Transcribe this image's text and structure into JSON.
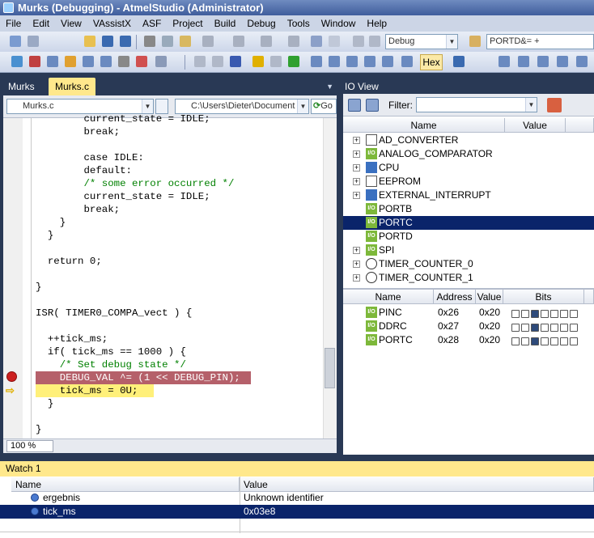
{
  "window": {
    "title": "Murks (Debugging) - AtmelStudio (Administrator)"
  },
  "menu": [
    "File",
    "Edit",
    "View",
    "VAssistX",
    "ASF",
    "Project",
    "Build",
    "Debug",
    "Tools",
    "Window",
    "Help"
  ],
  "toolbar": {
    "config": "Debug",
    "search_value": "PORTD&= +",
    "hex_label": "Hex"
  },
  "tabs": [
    {
      "label": "Murks"
    },
    {
      "label": "Murks.c"
    }
  ],
  "nav": {
    "file": "Murks.c",
    "path": "C:\\Users\\Dieter\\Document",
    "go": "Go"
  },
  "code": {
    "lines": [
      {
        "text": "        current_state = IDLE;",
        "kind": "normal"
      },
      {
        "text": "        break;",
        "kind": "normal"
      },
      {
        "text": "",
        "kind": "normal"
      },
      {
        "text": "        case IDLE:",
        "kind": "normal"
      },
      {
        "text": "        default:",
        "kind": "normal"
      },
      {
        "text": "        /* some error occurred */",
        "kind": "comment"
      },
      {
        "text": "        current_state = IDLE;",
        "kind": "normal"
      },
      {
        "text": "        break;",
        "kind": "normal"
      },
      {
        "text": "    }",
        "kind": "normal"
      },
      {
        "text": "  }",
        "kind": "normal"
      },
      {
        "text": "",
        "kind": "normal"
      },
      {
        "text": "  return 0;",
        "kind": "normal"
      },
      {
        "text": "",
        "kind": "normal"
      },
      {
        "text": "}",
        "kind": "normal"
      },
      {
        "text": "",
        "kind": "normal"
      },
      {
        "text": "ISR( TIMER0_COMPA_vect ) {",
        "kind": "normal"
      },
      {
        "text": "",
        "kind": "normal"
      },
      {
        "text": "  ++tick_ms;",
        "kind": "normal"
      },
      {
        "text": "  if( tick_ms == 1000 ) {",
        "kind": "normal"
      },
      {
        "text": "    /* Set debug state */",
        "kind": "comment"
      },
      {
        "text": "    DEBUG_VAL ^= (1 << DEBUG_PIN);",
        "kind": "breakpoint"
      },
      {
        "text": "    tick_ms = 0U;",
        "kind": "current"
      },
      {
        "text": "  }",
        "kind": "normal"
      },
      {
        "text": "",
        "kind": "normal"
      },
      {
        "text": "}",
        "kind": "normal"
      }
    ]
  },
  "zoom": "100 %",
  "ioview": {
    "title": "IO View",
    "filter_label": "Filter:",
    "columns": {
      "name": "Name",
      "value": "Value"
    },
    "items": [
      {
        "label": "AD_CONVERTER",
        "icon": "doc"
      },
      {
        "label": "ANALOG_COMPARATOR",
        "icon": "adc"
      },
      {
        "label": "CPU",
        "icon": "chip"
      },
      {
        "label": "EEPROM",
        "icon": "doc"
      },
      {
        "label": "EXTERNAL_INTERRUPT",
        "icon": "chip"
      },
      {
        "label": "PORTB",
        "icon": "io"
      },
      {
        "label": "PORTC",
        "icon": "io",
        "selected": true
      },
      {
        "label": "PORTD",
        "icon": "io"
      },
      {
        "label": "SPI",
        "icon": "io"
      },
      {
        "label": "TIMER_COUNTER_0",
        "icon": "clock"
      },
      {
        "label": "TIMER_COUNTER_1",
        "icon": "clock"
      }
    ],
    "reg_columns": {
      "name": "Name",
      "address": "Address",
      "value": "Value",
      "bits": "Bits"
    },
    "registers": [
      {
        "name": "PINC",
        "address": "0x26",
        "value": "0x20",
        "bits": [
          0,
          0,
          1,
          0,
          0,
          0,
          0
        ]
      },
      {
        "name": "DDRC",
        "address": "0x27",
        "value": "0x20",
        "bits": [
          0,
          0,
          1,
          0,
          0,
          0,
          0
        ]
      },
      {
        "name": "PORTC",
        "address": "0x28",
        "value": "0x20",
        "bits": [
          0,
          0,
          1,
          0,
          0,
          0,
          0
        ]
      }
    ]
  },
  "watch": {
    "title": "Watch 1",
    "columns": {
      "name": "Name",
      "value": "Value"
    },
    "rows": [
      {
        "name": "ergebnis",
        "value": "Unknown identifier"
      },
      {
        "name": "tick_ms",
        "value": "0x03e8",
        "selected": true
      }
    ]
  },
  "colors": {
    "accent": "#0a246a",
    "tab_active": "#ffe88c",
    "breakpoint_line": "#b5606a",
    "current_line": "#fff07a",
    "io_green": "#7db83a"
  }
}
